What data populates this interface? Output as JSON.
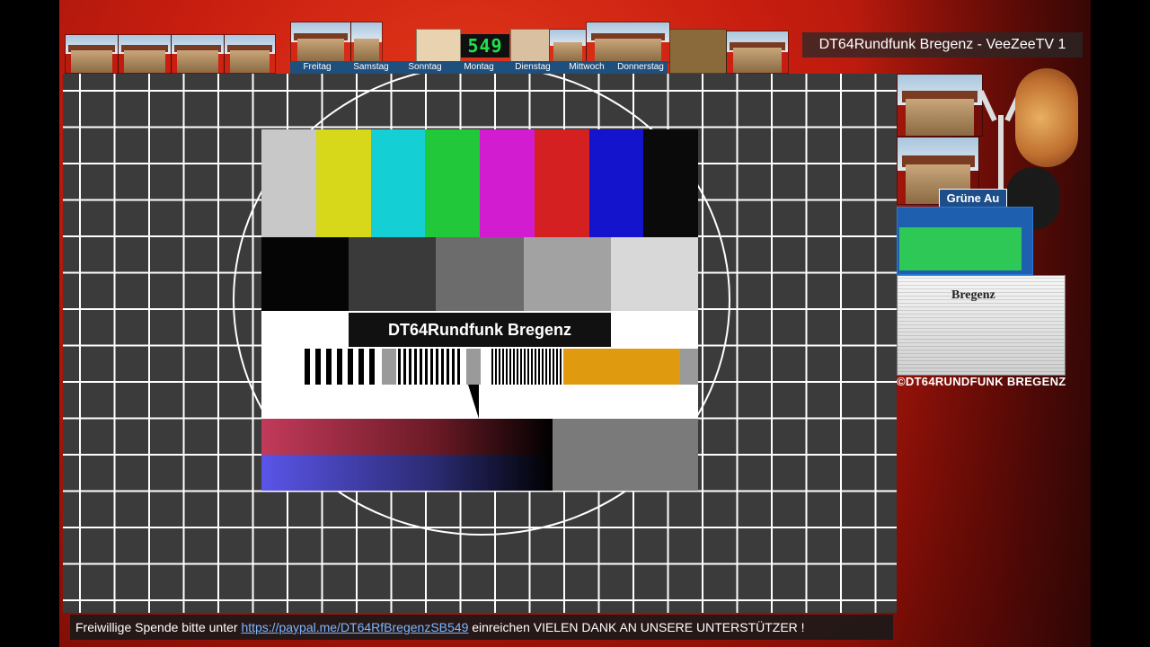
{
  "channel_title": "DT64Rundfunk Bregenz - VeeZeeTV 1",
  "clock_value": "549",
  "schedule_days": [
    "Freitag",
    "Samstag",
    "Sonntag",
    "Montag",
    "Dienstag",
    "Mittwoch",
    "Donnerstag"
  ],
  "testcard_label": "DT64Rundfunk Bregenz",
  "color_bars": [
    "#c8c8c8",
    "#d8d81a",
    "#14cfd4",
    "#20c83a",
    "#d21cd0",
    "#d42020",
    "#1414cc",
    "#0a0a0a"
  ],
  "grey_steps": [
    "#050505",
    "#3a3a3a",
    "#6c6c6c",
    "#a2a2a2",
    "#d8d8d8"
  ],
  "side_station_label": "Grüne Au",
  "copyright_text": "©DT64RUNDFUNK BREGENZ",
  "ticker": {
    "prefix": "Freiwillige Spende bitte unter ",
    "link_text": "https://paypal.me/DT64RfBregenzSB549",
    "suffix": " einreichen VIELEN  DANK AN UNSERE UNTERSTÜTZER !"
  }
}
